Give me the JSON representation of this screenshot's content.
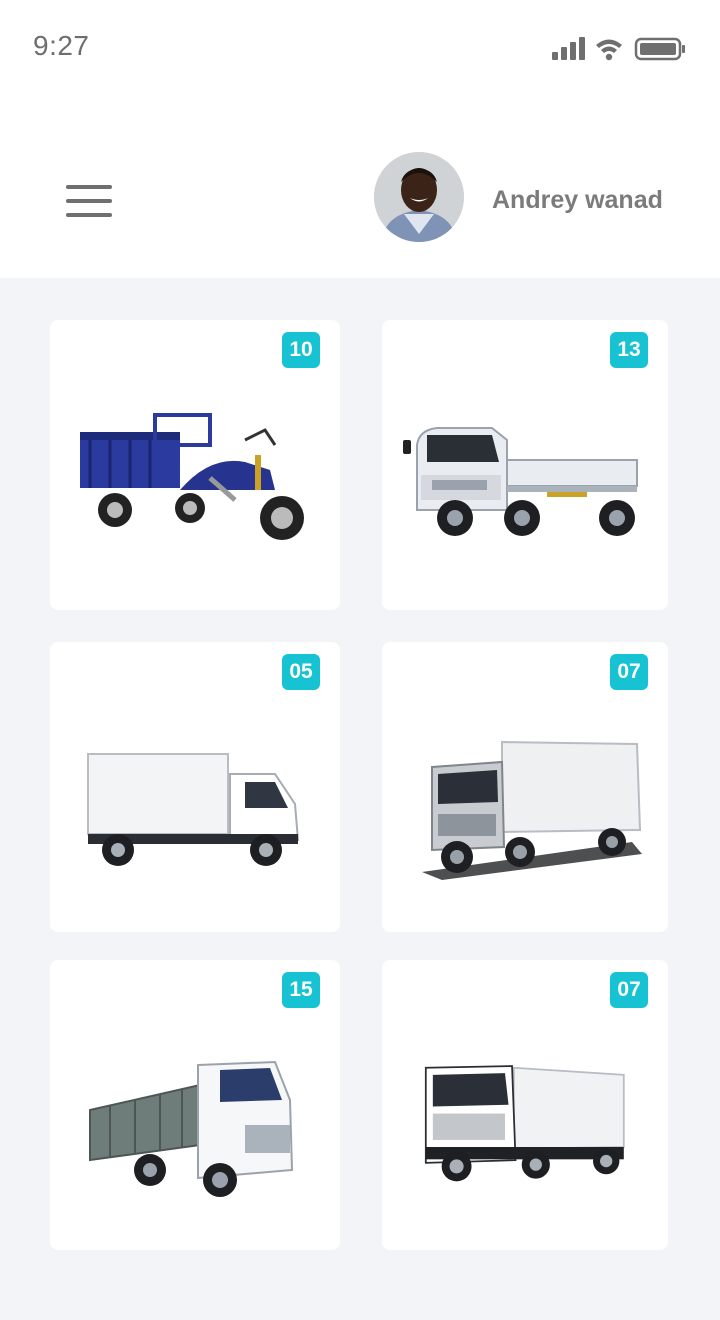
{
  "status_bar": {
    "time": "9:27",
    "icons": [
      "signal-icon",
      "wifi-icon",
      "battery-icon"
    ]
  },
  "header": {
    "user_name": "Andrey wanad",
    "menu_icon": "hamburger-menu-icon"
  },
  "colors": {
    "badge": "#17c3d3",
    "background": "#f2f4f8",
    "card": "#ffffff"
  },
  "vehicles": [
    {
      "count": "10",
      "type": "cargo-tricycle"
    },
    {
      "count": "13",
      "type": "flatbed-truck"
    },
    {
      "count": "05",
      "type": "box-truck-small"
    },
    {
      "count": "07",
      "type": "box-truck-large"
    },
    {
      "count": "15",
      "type": "stake-bed-truck"
    },
    {
      "count": "07",
      "type": "box-truck-heavy"
    }
  ]
}
